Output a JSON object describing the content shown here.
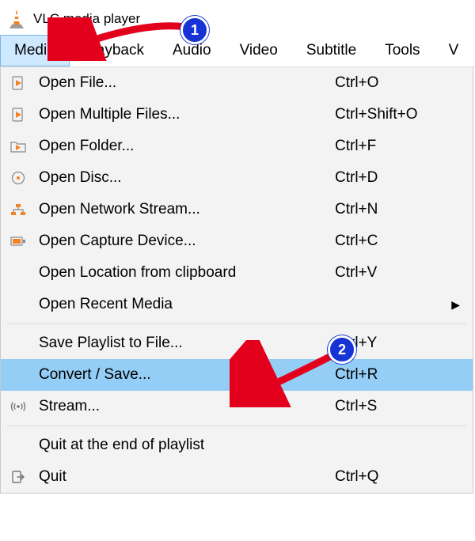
{
  "window": {
    "title": "VLC media player"
  },
  "menubar": {
    "items": [
      {
        "label": "Media",
        "open": true
      },
      {
        "label": "ayback",
        "open": false
      },
      {
        "label": "Audio",
        "open": false
      },
      {
        "label": "Video",
        "open": false
      },
      {
        "label": "Subtitle",
        "open": false
      },
      {
        "label": "Tools",
        "open": false
      },
      {
        "label": "V",
        "open": false
      }
    ]
  },
  "dropdown": {
    "items": [
      {
        "icon": "file-play",
        "label": "Open File...",
        "shortcut": "Ctrl+O"
      },
      {
        "icon": "file-play",
        "label": "Open Multiple Files...",
        "shortcut": "Ctrl+Shift+O"
      },
      {
        "icon": "folder-play",
        "label": "Open Folder...",
        "shortcut": "Ctrl+F"
      },
      {
        "icon": "disc",
        "label": "Open Disc...",
        "shortcut": "Ctrl+D"
      },
      {
        "icon": "network",
        "label": "Open Network Stream...",
        "shortcut": "Ctrl+N"
      },
      {
        "icon": "capture",
        "label": "Open Capture Device...",
        "shortcut": "Ctrl+C"
      },
      {
        "icon": "",
        "label": "Open Location from clipboard",
        "shortcut": "Ctrl+V"
      },
      {
        "icon": "",
        "label": "Open Recent Media",
        "submenu": true
      },
      {
        "sep": true
      },
      {
        "icon": "",
        "label": "Save Playlist to File...",
        "shortcut": "Ctrl+Y"
      },
      {
        "icon": "",
        "label": "Convert / Save...",
        "shortcut": "Ctrl+R",
        "highlight": true
      },
      {
        "icon": "stream",
        "label": "Stream...",
        "shortcut": "Ctrl+S"
      },
      {
        "sep": true
      },
      {
        "icon": "",
        "label": "Quit at the end of playlist"
      },
      {
        "icon": "quit",
        "label": "Quit",
        "shortcut": "Ctrl+Q"
      }
    ]
  },
  "annotations": {
    "badge1": "1",
    "badge2": "2"
  }
}
